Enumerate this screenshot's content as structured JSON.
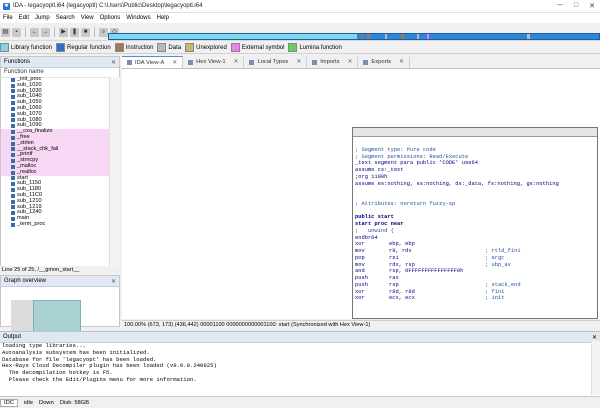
{
  "window": {
    "title": "IDA - legacyoptl.i64 (legacyoptl) C:\\Users\\Public\\Desktop\\legacyoptl.i64",
    "minimize": "─",
    "maximize": "□",
    "close": "✕"
  },
  "menu": [
    "File",
    "Edit",
    "Jump",
    "Search",
    "View",
    "Options",
    "Windows",
    "Help"
  ],
  "legend": [
    {
      "label": "Library function",
      "color": "#7fd8ea"
    },
    {
      "label": "Regular function",
      "color": "#2a6fc9"
    },
    {
      "label": "Instruction",
      "color": "#9c7a5b"
    },
    {
      "label": "Data",
      "color": "#b8b8b8"
    },
    {
      "label": "Unexplored",
      "color": "#c8b86a"
    },
    {
      "label": "External symbol",
      "color": "#f07ef0"
    },
    {
      "label": "Lumina function",
      "color": "#5fd25f"
    }
  ],
  "functions_panel": {
    "title": "Functions",
    "column": "Function name",
    "rows": [
      {
        "name": "_init_proc",
        "lib": false
      },
      {
        "name": "sub_1020",
        "lib": false
      },
      {
        "name": "sub_1030",
        "lib": false
      },
      {
        "name": "sub_1040",
        "lib": false
      },
      {
        "name": "sub_1050",
        "lib": false
      },
      {
        "name": "sub_1060",
        "lib": false
      },
      {
        "name": "sub_1070",
        "lib": false
      },
      {
        "name": "sub_1080",
        "lib": false
      },
      {
        "name": "sub_1090",
        "lib": false
      },
      {
        "name": "__cxa_finalize",
        "lib": true
      },
      {
        "name": "_free",
        "lib": true
      },
      {
        "name": "_strlen",
        "lib": true
      },
      {
        "name": "__stack_chk_fail",
        "lib": true
      },
      {
        "name": "_printf",
        "lib": true
      },
      {
        "name": "_strncpy",
        "lib": true
      },
      {
        "name": "_malloc",
        "lib": true
      },
      {
        "name": "_realloc",
        "lib": true
      },
      {
        "name": "start",
        "lib": false
      },
      {
        "name": "sub_1150",
        "lib": false
      },
      {
        "name": "sub_1180",
        "lib": false
      },
      {
        "name": "sub_11C0",
        "lib": false
      },
      {
        "name": "sub_1210",
        "lib": false
      },
      {
        "name": "sub_1219",
        "lib": false
      },
      {
        "name": "sub_1240",
        "lib": false
      },
      {
        "name": "main",
        "lib": false
      },
      {
        "name": "_term_proc",
        "lib": false
      }
    ],
    "status": "Line 25 of 25, /__gmon_start__"
  },
  "overview_panel": {
    "title": "Graph overview"
  },
  "tabs": [
    {
      "label": "IDA View-A",
      "active": true
    },
    {
      "label": "Hex View-1",
      "active": false
    },
    {
      "label": "Local Types",
      "active": false
    },
    {
      "label": "Imports",
      "active": false
    },
    {
      "label": "Exports",
      "active": false
    }
  ],
  "disasm": [
    {
      "kind": "blank",
      "text": ""
    },
    {
      "kind": "cmt",
      "text": "; Segment type: Pure code"
    },
    {
      "kind": "cmt",
      "text": "; Segment permissions: Read/Execute"
    },
    {
      "kind": "dir",
      "text": "_text segment para public 'CODE' use64"
    },
    {
      "kind": "dir",
      "text": "assume cs:_text"
    },
    {
      "kind": "dir",
      "text": ";org 1100h"
    },
    {
      "kind": "dir",
      "text": "assume es:nothing, ss:nothing, ds:_data, fs:nothing, gs:nothing"
    },
    {
      "kind": "blank",
      "text": ""
    },
    {
      "kind": "blank",
      "text": ""
    },
    {
      "kind": "cmt",
      "text": "; Attributes: noreturn fuzzy-sp"
    },
    {
      "kind": "blank",
      "text": ""
    },
    {
      "kind": "nav",
      "text": "public start"
    },
    {
      "kind": "nav",
      "text": "start proc near"
    },
    {
      "kind": "cmt",
      "text": ";   unwind {"
    },
    {
      "kind": "dir",
      "text": "endbr64"
    },
    {
      "kind": "ins",
      "op": "xor",
      "arg": "ebp, ebp",
      "rc": ""
    },
    {
      "kind": "ins",
      "op": "mov",
      "arg": "r9, rdx",
      "rc": "; rtld_fini"
    },
    {
      "kind": "ins",
      "op": "pop",
      "arg": "rsi",
      "rc": "; argc"
    },
    {
      "kind": "ins",
      "op": "mov",
      "arg": "rdx, rsp",
      "rc": "; ubp_av"
    },
    {
      "kind": "ins",
      "op": "and",
      "arg": "rsp, 0FFFFFFFFFFFFFFF0h",
      "rc": ""
    },
    {
      "kind": "ins",
      "op": "push",
      "arg": "rax",
      "rc": ""
    },
    {
      "kind": "ins",
      "op": "push",
      "arg": "rsp",
      "rc": "; stack_end"
    },
    {
      "kind": "ins",
      "op": "xor",
      "arg": "r8d, r8d",
      "rc": "; fini"
    },
    {
      "kind": "ins",
      "op": "xor",
      "arg": "ecx, ecx",
      "rc": "; init"
    }
  ],
  "view_status": "100.00% (673, 173) (436,442) 00001100 0000000000001100: start (Synchronized with Hex View-1)",
  "output": {
    "title": "Output",
    "lines": [
      "loading type libraries...",
      "Autoanalysis subsystem has been initialized.",
      "Database for file 'legacyopt' has been loaded.",
      "Hex-Rays Cloud Decompiler plugin has been loaded (v9.0.0.240925)",
      "  The decompilation hotkey is F5.",
      "  Please check the Edit/Plugins menu for more information."
    ]
  },
  "statusbar": {
    "lang": "IDC",
    "state": "idle",
    "dir": "Down",
    "disk": "Disk: 58GB"
  }
}
